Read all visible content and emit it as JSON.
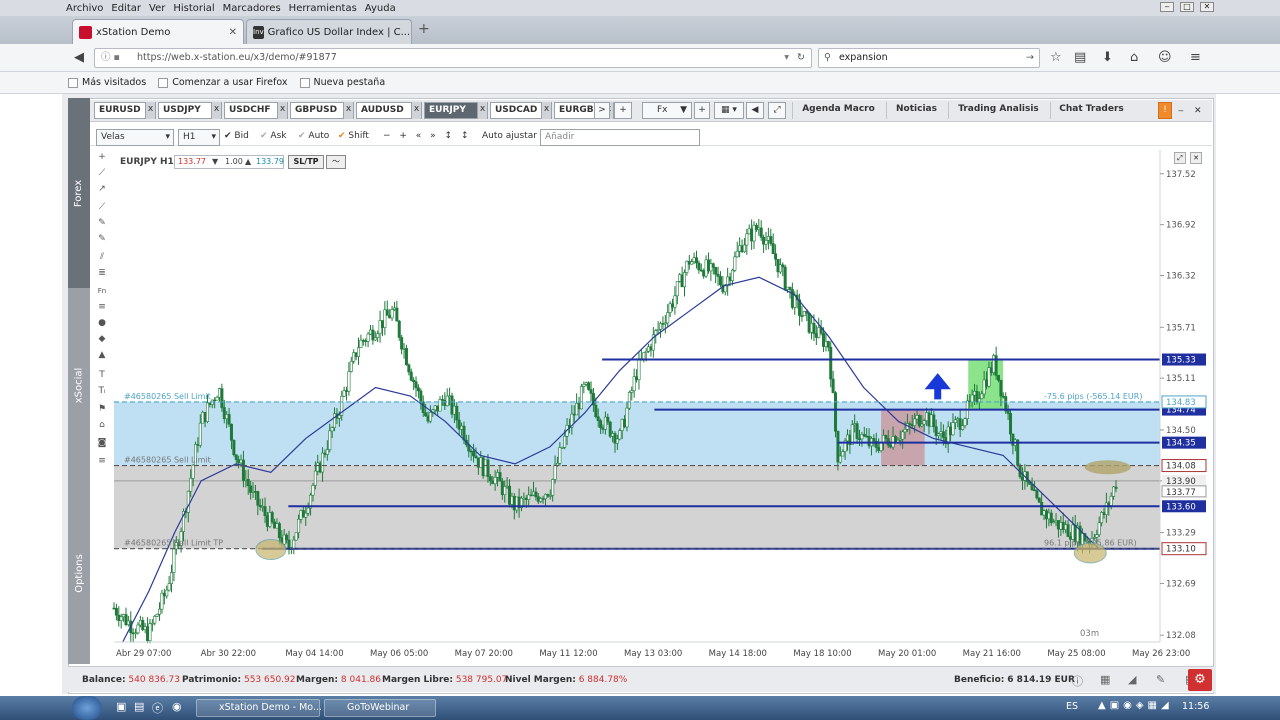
{
  "menubar": [
    "Archivo",
    "Editar",
    "Ver",
    "Historial",
    "Marcadores",
    "Herramientas",
    "Ayuda"
  ],
  "tabs": [
    {
      "title": "xStation Demo",
      "active": true
    },
    {
      "title": "Grafico US Dollar Index | C...",
      "active": false
    }
  ],
  "nav": {
    "url": "https://web.x-station.eu/x3/demo/#91877",
    "search_value": "expansion"
  },
  "bookmarks": [
    "Más visitados",
    "Comenzar a usar Firefox",
    "Nueva pestaña"
  ],
  "side_tabs": [
    "Forex",
    "xSocial",
    "Options"
  ],
  "symbols": [
    "EURUSD",
    "USDJPY",
    "USDCHF",
    "GBPUSD",
    "AUDUSD",
    "EURJPY",
    "USDCAD",
    "EURGBP"
  ],
  "active_symbol": "EURJPY",
  "top_menu": {
    "fx": "Fx",
    "agenda": "Agenda Macro",
    "noticias": "Noticias",
    "trading": "Trading Analisis",
    "chat": "Chat Traders"
  },
  "toolbar": {
    "chart_type": "Velas",
    "interval": "H1",
    "bid": "Bid",
    "ask": "Ask",
    "auto": "Auto",
    "shift": "Shift",
    "auto_adjust": "Auto ajustar",
    "add_placeholder": "Añadir"
  },
  "chart_header": {
    "symbol": "EURJPY H1",
    "sell_price": "133.77",
    "volume": "1.00",
    "buy_price": "133.79",
    "sltp": "SL/TP"
  },
  "chart_data": {
    "type": "candlestick",
    "symbol": "EURJPY",
    "interval": "H1",
    "y_ticks": [
      132.08,
      132.69,
      133.29,
      133.9,
      134.5,
      135.11,
      135.71,
      136.32,
      136.92,
      137.52
    ],
    "ylim": [
      132.0,
      137.8
    ],
    "x_ticks": [
      "Abr 29 07:00",
      "Abr 30 22:00",
      "May 04 14:00",
      "May 06 05:00",
      "May 07 20:00",
      "May 11 12:00",
      "May 13 03:00",
      "May 14 18:00",
      "May 18 10:00",
      "May 20 01:00",
      "May 21 16:00",
      "May 25 08:00",
      "May 26 23:00"
    ],
    "price_path": [
      [
        0,
        132.4
      ],
      [
        4,
        132.2
      ],
      [
        8,
        132.1
      ],
      [
        12,
        132.6
      ],
      [
        16,
        133.5
      ],
      [
        20,
        134.6
      ],
      [
        24,
        135.0
      ],
      [
        28,
        134.2
      ],
      [
        32,
        133.7
      ],
      [
        36,
        133.4
      ],
      [
        40,
        133.1
      ],
      [
        44,
        133.6
      ],
      [
        48,
        134.2
      ],
      [
        52,
        134.8
      ],
      [
        56,
        135.5
      ],
      [
        60,
        135.7
      ],
      [
        64,
        135.9
      ],
      [
        68,
        135.2
      ],
      [
        72,
        134.6
      ],
      [
        76,
        134.9
      ],
      [
        80,
        134.5
      ],
      [
        84,
        134.1
      ],
      [
        88,
        133.9
      ],
      [
        92,
        133.6
      ],
      [
        96,
        133.7
      ],
      [
        100,
        133.8
      ],
      [
        104,
        134.5
      ],
      [
        108,
        135.0
      ],
      [
        112,
        134.6
      ],
      [
        116,
        134.4
      ],
      [
        120,
        135.2
      ],
      [
        124,
        135.6
      ],
      [
        128,
        136.0
      ],
      [
        132,
        136.5
      ],
      [
        136,
        136.4
      ],
      [
        140,
        136.2
      ],
      [
        144,
        136.7
      ],
      [
        148,
        136.9
      ],
      [
        152,
        136.5
      ],
      [
        156,
        136.0
      ],
      [
        160,
        135.7
      ],
      [
        164,
        135.5
      ],
      [
        166,
        134.2
      ],
      [
        170,
        134.5
      ],
      [
        174,
        134.3
      ],
      [
        178,
        134.4
      ],
      [
        182,
        134.5
      ],
      [
        186,
        134.7
      ],
      [
        190,
        134.4
      ],
      [
        194,
        134.6
      ],
      [
        198,
        134.9
      ],
      [
        202,
        135.3
      ],
      [
        205,
        134.7
      ],
      [
        208,
        134.0
      ],
      [
        212,
        133.6
      ],
      [
        216,
        133.4
      ],
      [
        220,
        133.3
      ],
      [
        224,
        133.2
      ],
      [
        228,
        133.6
      ],
      [
        230,
        133.9
      ]
    ],
    "moving_average": [
      [
        2,
        132.0
      ],
      [
        8,
        132.6
      ],
      [
        14,
        133.3
      ],
      [
        20,
        133.9
      ],
      [
        28,
        134.1
      ],
      [
        36,
        134.0
      ],
      [
        44,
        134.4
      ],
      [
        52,
        134.7
      ],
      [
        60,
        135.0
      ],
      [
        68,
        134.9
      ],
      [
        76,
        134.6
      ],
      [
        84,
        134.2
      ],
      [
        92,
        134.1
      ],
      [
        100,
        134.3
      ],
      [
        108,
        134.7
      ],
      [
        116,
        135.2
      ],
      [
        124,
        135.6
      ],
      [
        132,
        135.9
      ],
      [
        140,
        136.2
      ],
      [
        148,
        136.3
      ],
      [
        156,
        136.1
      ],
      [
        164,
        135.6
      ],
      [
        172,
        135.0
      ],
      [
        180,
        134.6
      ],
      [
        188,
        134.4
      ],
      [
        196,
        134.3
      ],
      [
        204,
        134.2
      ],
      [
        212,
        133.8
      ],
      [
        220,
        133.4
      ],
      [
        226,
        133.1
      ]
    ],
    "horizontal_levels": [
      {
        "price": 135.33,
        "label": "135.33"
      },
      {
        "price": 134.74,
        "label": "134.74"
      },
      {
        "price": 134.35,
        "label": "134.35"
      },
      {
        "price": 133.6,
        "label": "133.60"
      },
      {
        "price": 133.1,
        "label": "133.10"
      }
    ],
    "orders": [
      {
        "label": "#46580265 Sell Limit",
        "price": 134.83,
        "price_label": "134.83",
        "note": "-75.6 pips (-565.14 EUR)"
      },
      {
        "label": "#46580265 Sell Limit",
        "price": 134.08,
        "price_label": "134.08",
        "note": ""
      },
      {
        "label": "#46580265 Sell Limit TP",
        "price": 133.1,
        "price_label": "133.10",
        "note": "96.1 pips (725.86 EUR)"
      }
    ],
    "current_price": {
      "bid": "133.90",
      "ask": "133.77"
    },
    "time_label": "03m"
  },
  "status": {
    "balance_label": "Balance:",
    "balance": "540 836.73",
    "equity_label": "Patrimonio:",
    "equity": "553 650.92",
    "margin_label": "Margen:",
    "margin": "8 041.86",
    "free_margin_label": "Margen Libre:",
    "free_margin": "538 795.07",
    "margin_level_label": "Nivel Margen:",
    "margin_level": "6 884.78%",
    "profit_label": "Beneficio:",
    "profit": "6 814.19 EUR"
  },
  "taskbar": {
    "items": [
      "xStation Demo - Mo...",
      "GoToWebinar"
    ],
    "lang": "ES",
    "clock": "11:56"
  },
  "colors": {
    "up": "#1f7a3a",
    "down": "#1f7a3a",
    "level": "#1f2fa0",
    "zone_blue": "#bfe0f2",
    "zone_gray": "#d3d3d3",
    "ma": "#2b3a9a",
    "red_value": "#d0302f"
  }
}
